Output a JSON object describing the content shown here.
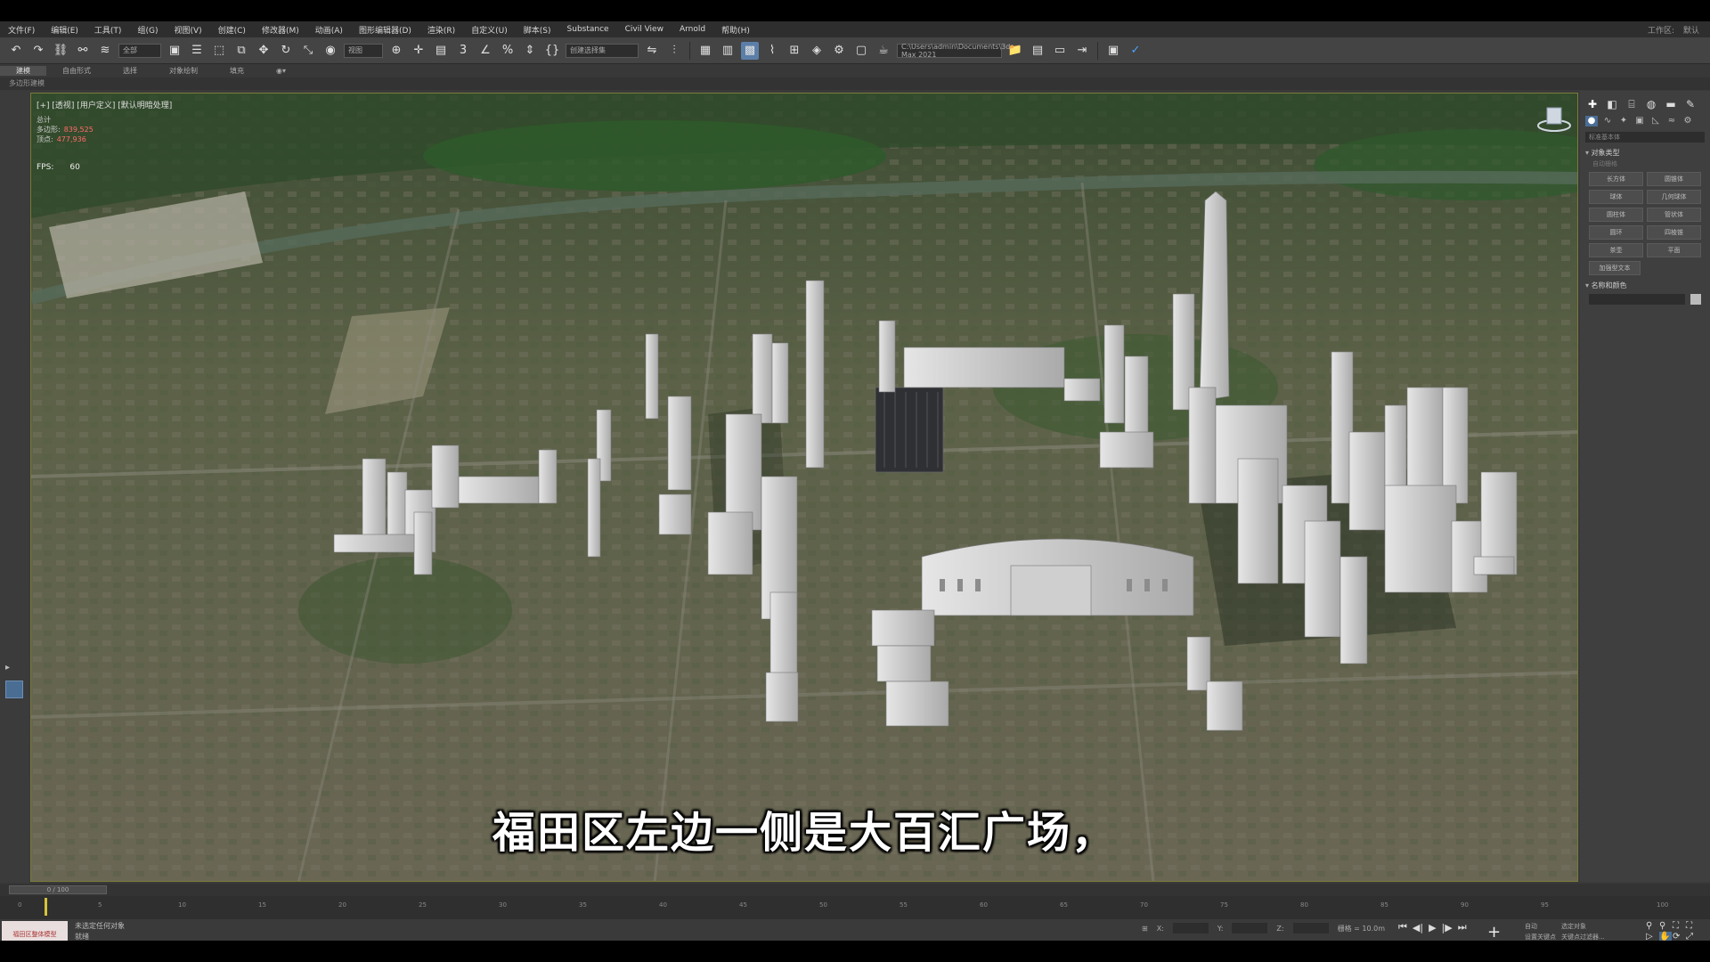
{
  "menu": {
    "items": [
      "文件(F)",
      "编辑(E)",
      "工具(T)",
      "组(G)",
      "视图(V)",
      "创建(C)",
      "修改器(M)",
      "动画(A)",
      "图形编辑器(D)",
      "渲染(R)",
      "自定义(U)",
      "脚本(S)",
      "Substance",
      "Civil View",
      "Arnold",
      "帮助(H)"
    ],
    "right_items": [
      "工作区:",
      "默认"
    ]
  },
  "toolbar": {
    "filter_dropdown": "全部",
    "ref_coord_dropdown": "视图",
    "selection_set_dropdown": "创建选择集",
    "project_path": "C:\\Users\\admin\\Documents\\3ds Max 2021"
  },
  "ribbon": {
    "tabs": [
      "建模",
      "自由形式",
      "选择",
      "对象绘制",
      "填充"
    ],
    "subtitle": "多边形建模"
  },
  "viewport": {
    "label": "[+] [透视] [用户定义] [默认明暗处理]",
    "stats": [
      {
        "key": "总计",
        "value": ""
      },
      {
        "key": "多边形:",
        "value": "839,525"
      },
      {
        "key": "顶点:",
        "value": "477,936"
      }
    ],
    "fps_label": "FPS:",
    "fps_value": "60",
    "subtitle": "福田区左边一侧是大百汇广场，"
  },
  "command_panel": {
    "tabs": [
      "create-icon",
      "modify-icon",
      "hierarchy-icon",
      "motion-icon",
      "display-icon",
      "utilities-icon"
    ],
    "category_dropdown": "标准基本体",
    "object_type_rollout": "对象类型",
    "autogrid": "自动栅格",
    "buttons": [
      "长方体",
      "圆锥体",
      "球体",
      "几何球体",
      "圆柱体",
      "管状体",
      "圆环",
      "四棱锥",
      "茶壶",
      "平面"
    ],
    "extra_button": "加强型文本",
    "name_color_rollout": "名称和颜色"
  },
  "timeline": {
    "slider_label": "0 / 100",
    "ticks": [
      "0",
      "5",
      "10",
      "15",
      "20",
      "25",
      "30",
      "35",
      "40",
      "45",
      "50",
      "55",
      "60",
      "65",
      "70",
      "75",
      "80",
      "85",
      "90",
      "95",
      "100"
    ]
  },
  "statusbar": {
    "thumbnail_label": "福田区整体模型",
    "status_line1": "未选定任何对象",
    "status_line2": "就绪",
    "x_label": "X:",
    "y_label": "Y:",
    "z_label": "Z:",
    "grid_label": "栅格 = 10.0m",
    "autokey_label": "自动",
    "setkey_label": "设置关键点",
    "selected_dropdown": "选定对象",
    "keyfilter_label": "关键点过滤器..."
  },
  "colors": {
    "accent": "#4a6d93",
    "menu_bg": "#2e2e2e",
    "toolbar_bg": "#444444",
    "viewport_border": "#7a7a3a",
    "stats_value": "#ff6a6a",
    "time_cursor": "#d6c23a"
  }
}
